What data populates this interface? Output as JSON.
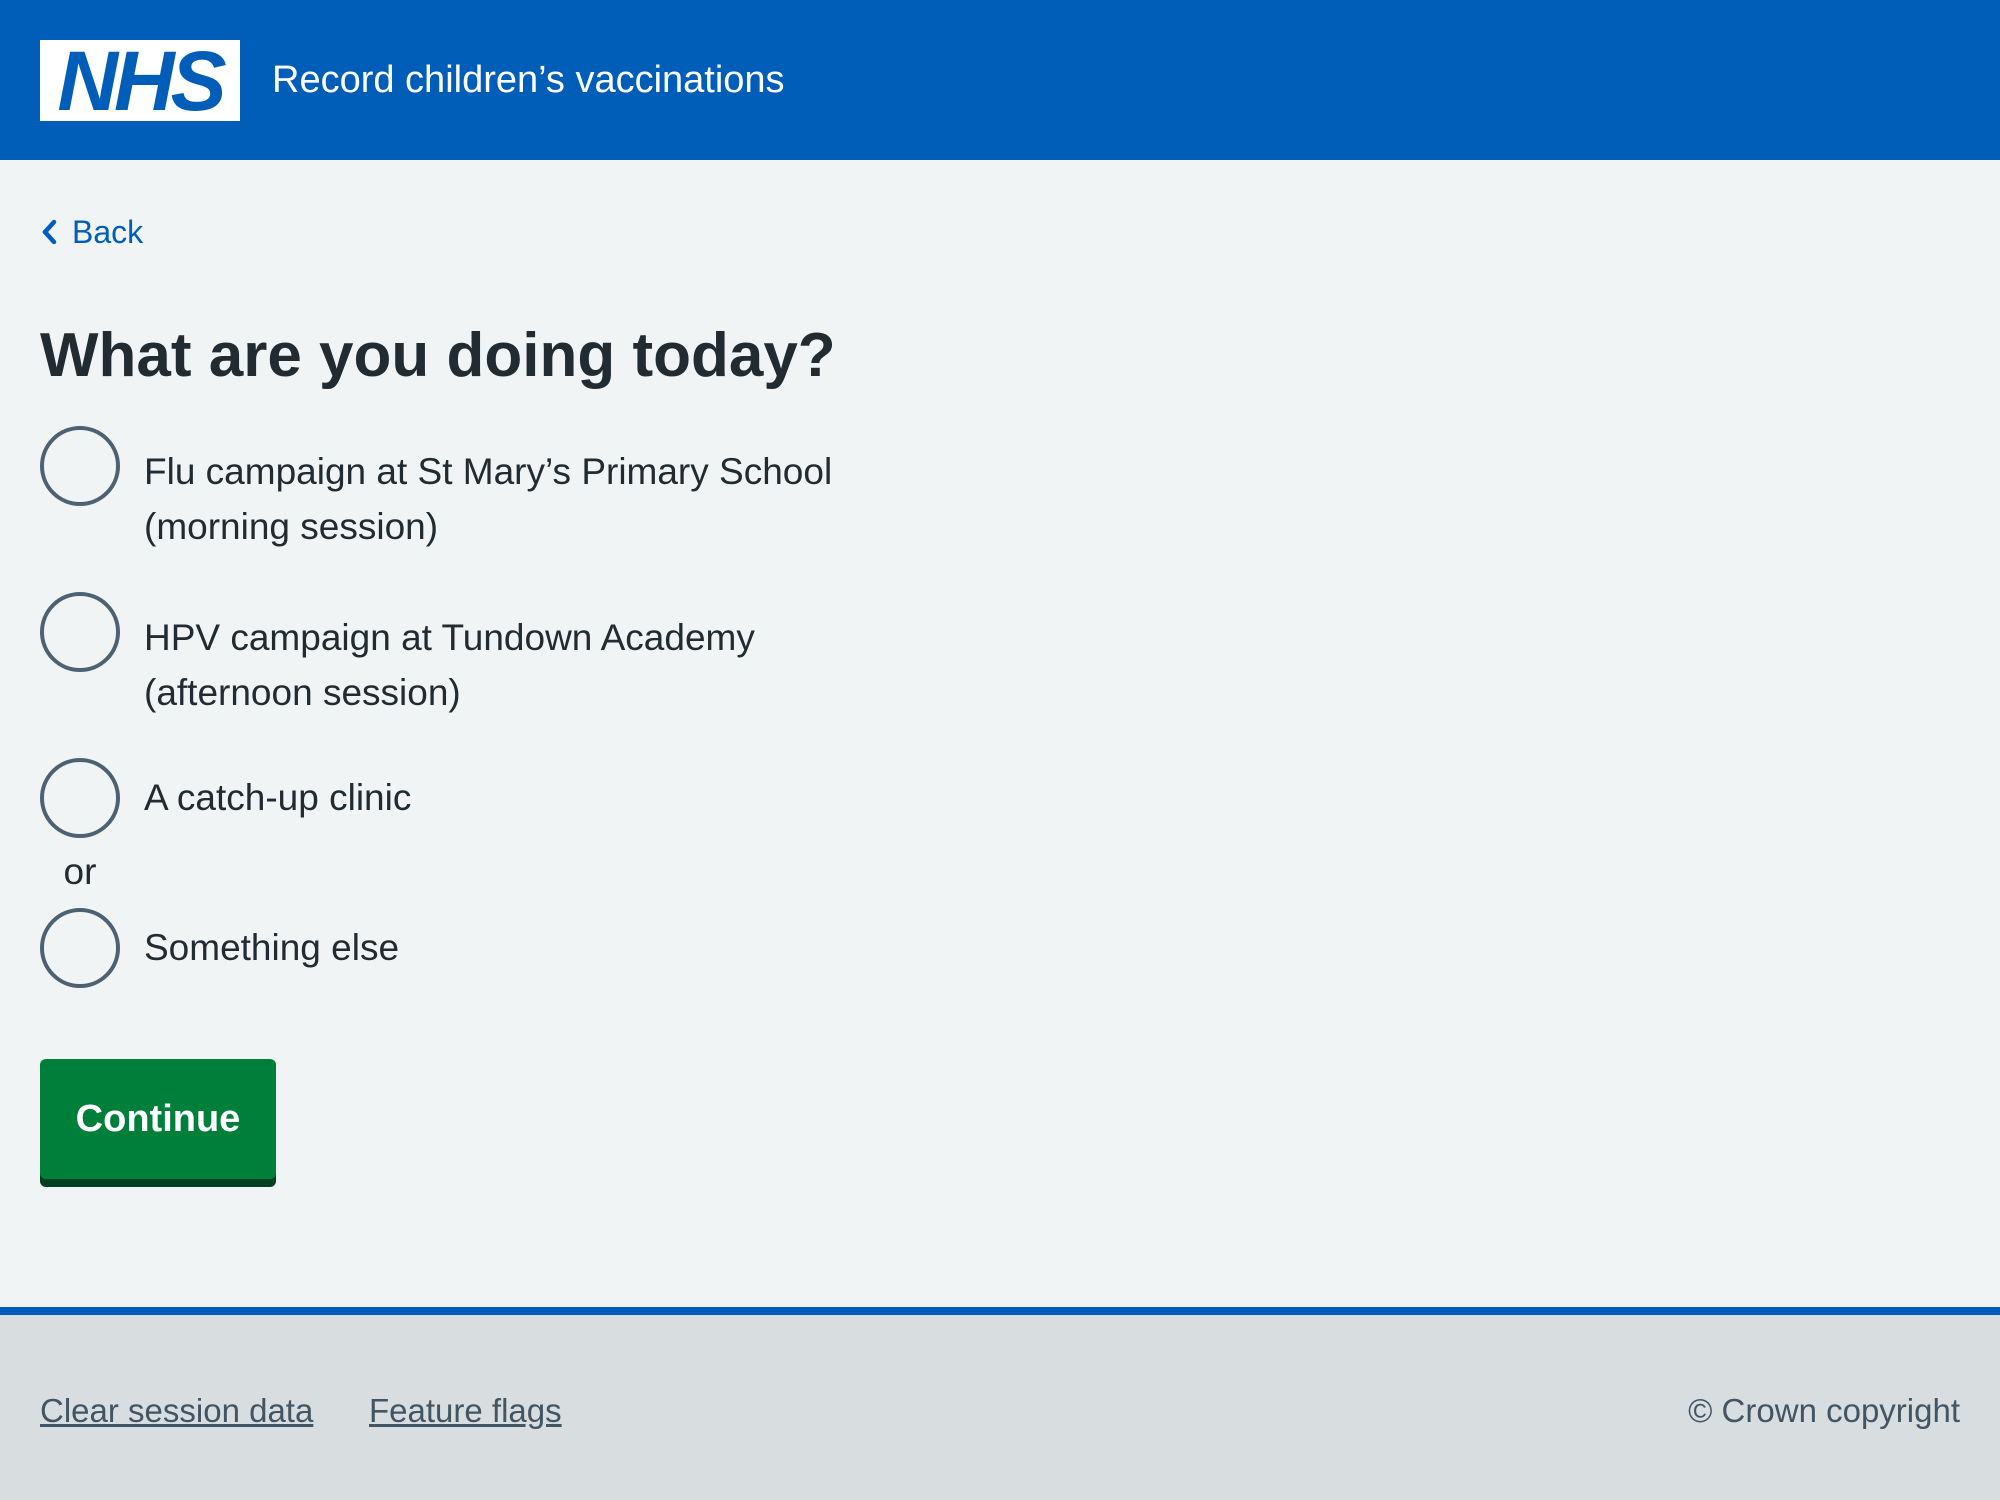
{
  "header": {
    "logo_text": "NHS",
    "service_name": "Record children’s vaccinations"
  },
  "nav": {
    "back_label": "Back"
  },
  "main": {
    "title": "What are you doing today?",
    "options": [
      {
        "line1": "Flu campaign at St Mary’s Primary School",
        "line2": "(morning session)",
        "selected": false
      },
      {
        "line1": "HPV campaign at Tundown Academy",
        "line2": "(afternoon session)",
        "selected": false
      },
      {
        "line1": "A catch-up clinic",
        "selected": false
      },
      {
        "line1": "Something else",
        "selected": false
      }
    ],
    "divider": "or",
    "continue_label": "Continue"
  },
  "footer": {
    "links": [
      "Clear session data",
      "Feature flags"
    ],
    "copyright": "© Crown copyright"
  },
  "colors": {
    "brand_blue": "#005eb8",
    "page_bg": "#f0f4f5",
    "button_green": "#007f3b",
    "footer_bg": "#d8dde0",
    "text": "#212b32",
    "secondary_text": "#425563"
  }
}
